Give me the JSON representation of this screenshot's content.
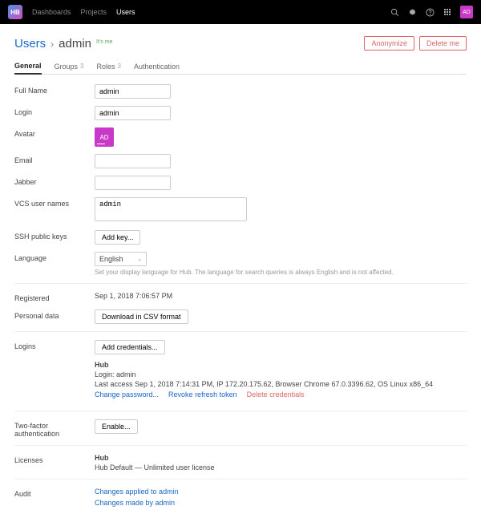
{
  "nav": {
    "dashboards": "Dashboards",
    "projects": "Projects",
    "users": "Users"
  },
  "avatar_initials": "AD",
  "header": {
    "users_link": "Users",
    "separator": "›",
    "username": "admin",
    "its_me": "It's me",
    "anonymize": "Anonymize",
    "delete_me": "Delete me"
  },
  "tabs": {
    "general": "General",
    "groups": "Groups",
    "groups_count": "3",
    "roles": "Roles",
    "roles_count": "3",
    "authentication": "Authentication"
  },
  "labels": {
    "full_name": "Full Name",
    "login": "Login",
    "avatar": "Avatar",
    "email": "Email",
    "jabber": "Jabber",
    "vcs": "VCS user names",
    "ssh": "SSH public keys",
    "language": "Language",
    "registered": "Registered",
    "personal_data": "Personal data",
    "logins": "Logins",
    "two_factor": "Two-factor authentication",
    "licenses": "Licenses",
    "audit": "Audit"
  },
  "values": {
    "full_name": "admin",
    "login": "admin",
    "vcs": "admin",
    "language_selected": "English",
    "language_hint": "Set your display language for Hub. The language for search queries is always English and is not affected.",
    "registered": "Sep 1, 2018 7:06:57 PM"
  },
  "buttons": {
    "add_key": "Add key...",
    "download_csv": "Download in CSV format",
    "add_credentials": "Add credentials...",
    "enable": "Enable..."
  },
  "credentials": {
    "title": "Hub",
    "login_line": "Login: admin",
    "last_access": "Last access Sep 1, 2018 7:14:31 PM, IP 172.20.175.62, Browser Chrome 67.0.3396.62, OS Linux x86_64",
    "change_password": "Change password...",
    "revoke_token": "Revoke refresh token",
    "delete_credentials": "Delete credentials"
  },
  "licenses": {
    "title": "Hub",
    "detail": "Hub Default — Unlimited user license"
  },
  "audit": {
    "applied": "Changes applied to admin",
    "made": "Changes made by admin"
  }
}
